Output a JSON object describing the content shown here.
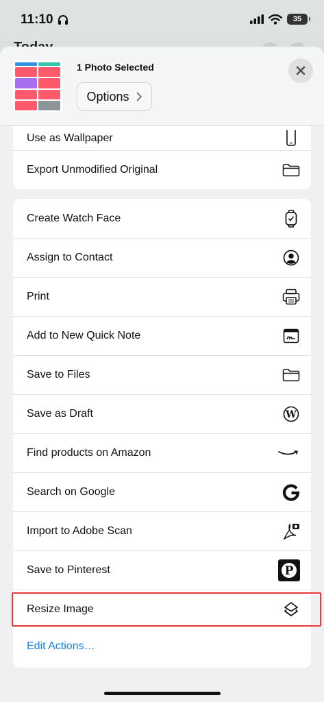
{
  "status": {
    "time": "11:10",
    "battery": "35"
  },
  "background": {
    "title": "Today"
  },
  "sheet": {
    "selection_label": "1 Photo Selected",
    "options_label": "Options"
  },
  "group1": [
    {
      "label": "Use as Wallpaper",
      "icon": "phone-icon"
    },
    {
      "label": "Export Unmodified Original",
      "icon": "folder-icon"
    }
  ],
  "group2": [
    {
      "label": "Create Watch Face",
      "icon": "watch-icon"
    },
    {
      "label": "Assign to Contact",
      "icon": "contact-icon"
    },
    {
      "label": "Print",
      "icon": "printer-icon"
    },
    {
      "label": "Add to New Quick Note",
      "icon": "quick-note-icon"
    },
    {
      "label": "Save to Files",
      "icon": "folder-icon"
    },
    {
      "label": "Save as Draft",
      "icon": "wordpress-icon"
    },
    {
      "label": "Find products on Amazon",
      "icon": "amazon-icon"
    },
    {
      "label": "Search on Google",
      "icon": "google-icon"
    },
    {
      "label": "Import to Adobe Scan",
      "icon": "adobe-scan-icon"
    },
    {
      "label": "Save to Pinterest",
      "icon": "pinterest-icon"
    },
    {
      "label": "Resize Image",
      "icon": "layers-icon"
    }
  ],
  "edit_actions_label": "Edit Actions…",
  "colors": {
    "accent": "#1a7fe0",
    "highlight": "#e5393b"
  }
}
